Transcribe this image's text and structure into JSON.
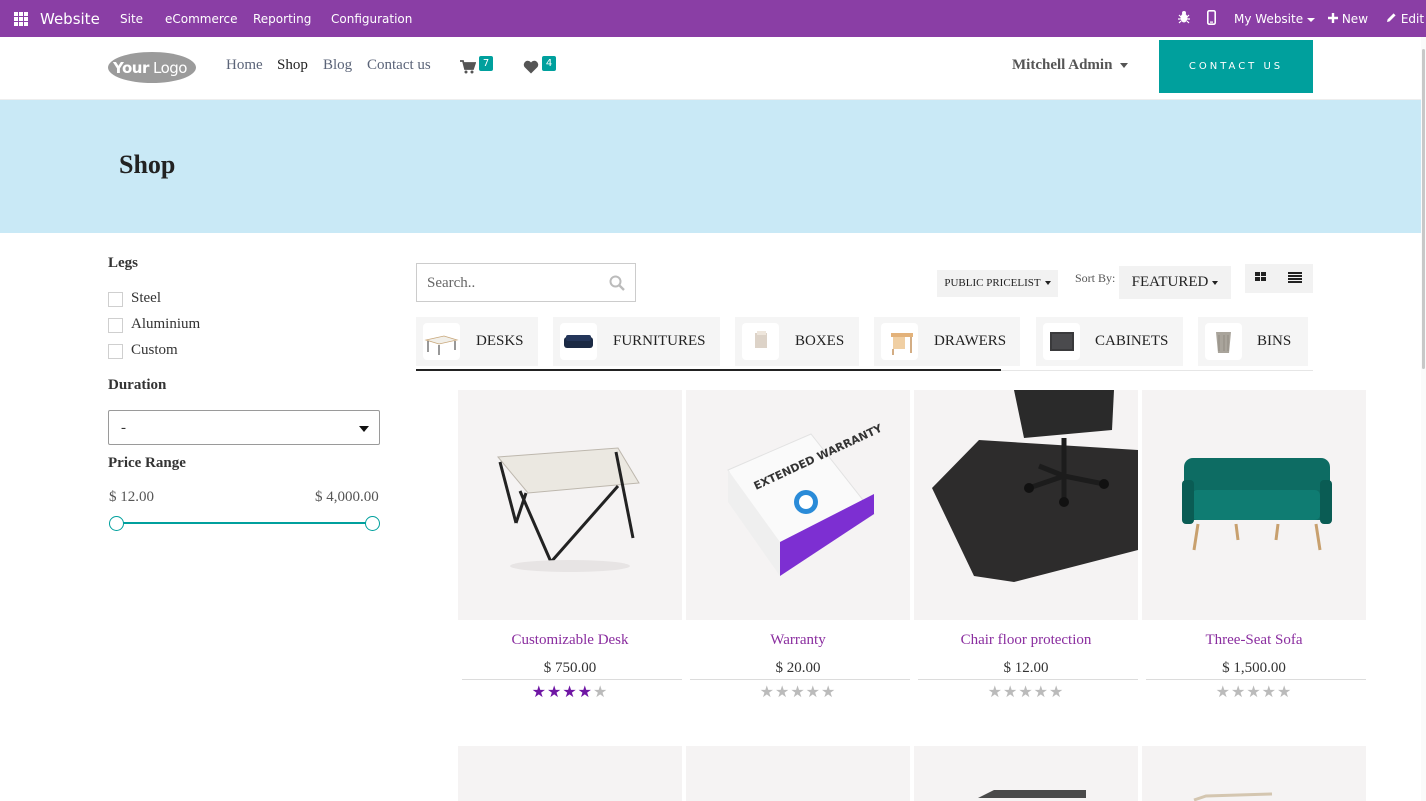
{
  "topbar": {
    "app_name": "Website",
    "menu": [
      "Site",
      "eCommerce",
      "Reporting",
      "Configuration"
    ],
    "website_selector": "My Website",
    "new_label": "New",
    "edit_label": "Edit"
  },
  "header": {
    "logo_text": "YourLogo",
    "nav": [
      "Home",
      "Shop",
      "Blog",
      "Contact us"
    ],
    "active_nav": "Shop",
    "cart_count": "7",
    "wishlist_count": "4",
    "user_name": "Mitchell Admin",
    "contact_button": "CONTACT US"
  },
  "banner": {
    "title": "Shop"
  },
  "filters": {
    "legs_title": "Legs",
    "legs_options": [
      "Steel",
      "Aluminium",
      "Custom"
    ],
    "duration_title": "Duration",
    "duration_value": "-",
    "price_title": "Price Range",
    "price_min": "$ 12.00",
    "price_max": "$ 4,000.00",
    "range_low_fraction": 0.0,
    "range_high_fraction": 1.0
  },
  "toolbar": {
    "search_placeholder": "Search..",
    "pricelist_label": "PUBLIC PRICELIST",
    "sort_label": "Sort By:",
    "sort_value": "FEATURED"
  },
  "categories": [
    "DESKS",
    "FURNITURES",
    "BOXES",
    "DRAWERS",
    "CABINETS",
    "BINS"
  ],
  "products": [
    {
      "name": "Customizable Desk",
      "price": "$ 750.00",
      "rating": 4
    },
    {
      "name": "Warranty",
      "price": "$ 20.00",
      "rating": 0
    },
    {
      "name": "Chair floor protection",
      "price": "$ 12.00",
      "rating": 0
    },
    {
      "name": "Three-Seat Sofa",
      "price": "$ 1,500.00",
      "rating": 0
    }
  ],
  "warranty_box_text": "EXTENDED WARRANTY",
  "colors": {
    "admin_bar": "#8a3ea5",
    "accent": "#00a09d",
    "banner": "#c9e9f6",
    "product_link": "#8a2d9f",
    "star_active": "#6f16a4"
  }
}
